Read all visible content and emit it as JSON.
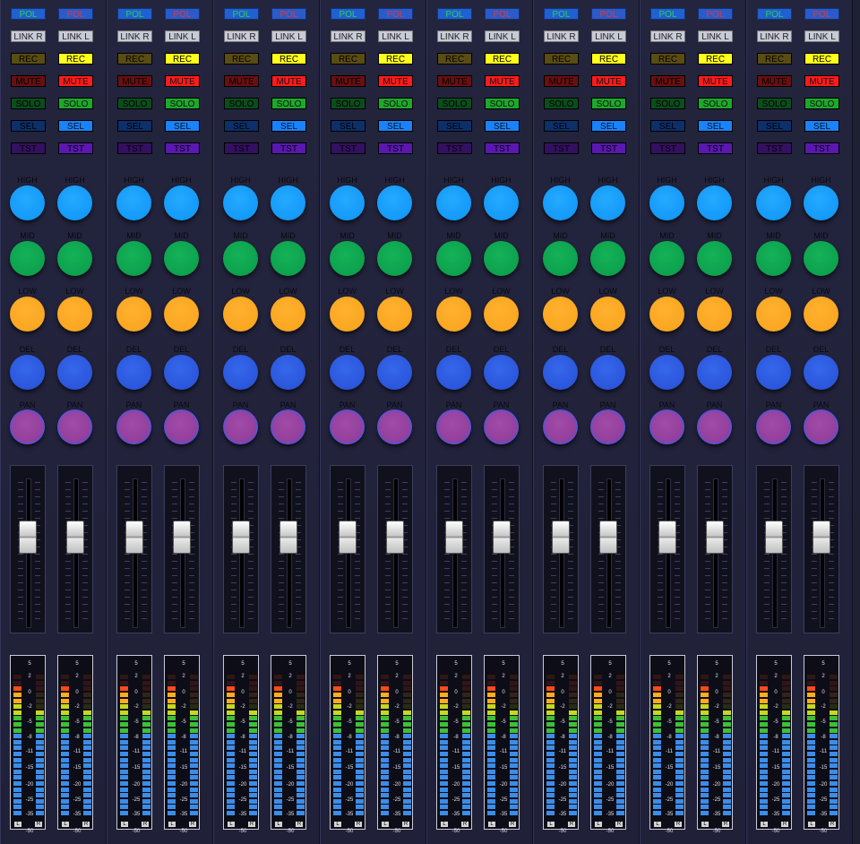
{
  "mixer": {
    "channel_pairs": 8,
    "buttons": {
      "pol": "POL",
      "link_left_strip": "LINK R",
      "link_right_strip": "LINK L",
      "rec": "REC",
      "mute": "MUTE",
      "solo": "SOLO",
      "sel": "SEL",
      "tst": "TST"
    },
    "knobs": {
      "high": "HIGH",
      "mid": "MID",
      "low": "LOW",
      "del": "DEL",
      "pan": "PAN"
    },
    "meter_scale": [
      "5",
      "2",
      "0",
      "-2",
      "-5",
      "-8",
      "-11",
      "-15",
      "-20",
      "-25",
      "-35",
      "-50"
    ],
    "meter_channel_labels": {
      "left": "L",
      "right": "R"
    },
    "meter_levels": {
      "left_strip_left_channel": 0.92,
      "left_strip_right_channel": 0.74,
      "right_strip_left_channel": 0.92,
      "right_strip_right_channel": 0.74
    },
    "colors": {
      "pol": "#2060d0",
      "rec_active": "#ffff1a",
      "mute_active": "#ff1b1b",
      "solo_active": "#1ea82b",
      "sel_active": "#1a82ff",
      "tst_active": "#5a18b0",
      "knob_high": "#0d93f6",
      "knob_mid": "#0a9a4a",
      "knob_low": "#f8a21c",
      "knob_del": "#274fd4",
      "knob_pan": "#8c3a96",
      "meter_peak": "#ff4a1a",
      "meter_hot": "#ffae1a",
      "meter_mid": "#c8d81e",
      "meter_green": "#3fbf39",
      "meter_low": "#3d8ce8"
    }
  }
}
